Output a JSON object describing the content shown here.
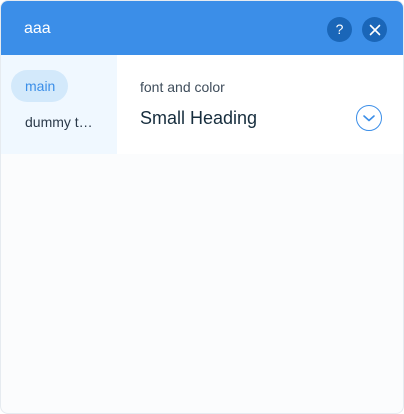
{
  "header": {
    "title": "aaa",
    "help_label": "?",
    "close_icon": "close-icon",
    "background": "#3b8ee8"
  },
  "sidebar": {
    "items": [
      {
        "label": "main",
        "selected": true
      },
      {
        "label": "dummy t…",
        "selected": false
      }
    ]
  },
  "main": {
    "section_label": "font and color",
    "select": {
      "value": "Small Heading",
      "icon": "chevron-down-icon"
    }
  },
  "colors": {
    "accent": "#3b8ee8",
    "header_button": "#1a66b8",
    "sidebar_bg": "#f0f8ff",
    "selected_item_bg": "#d3e9fb"
  }
}
